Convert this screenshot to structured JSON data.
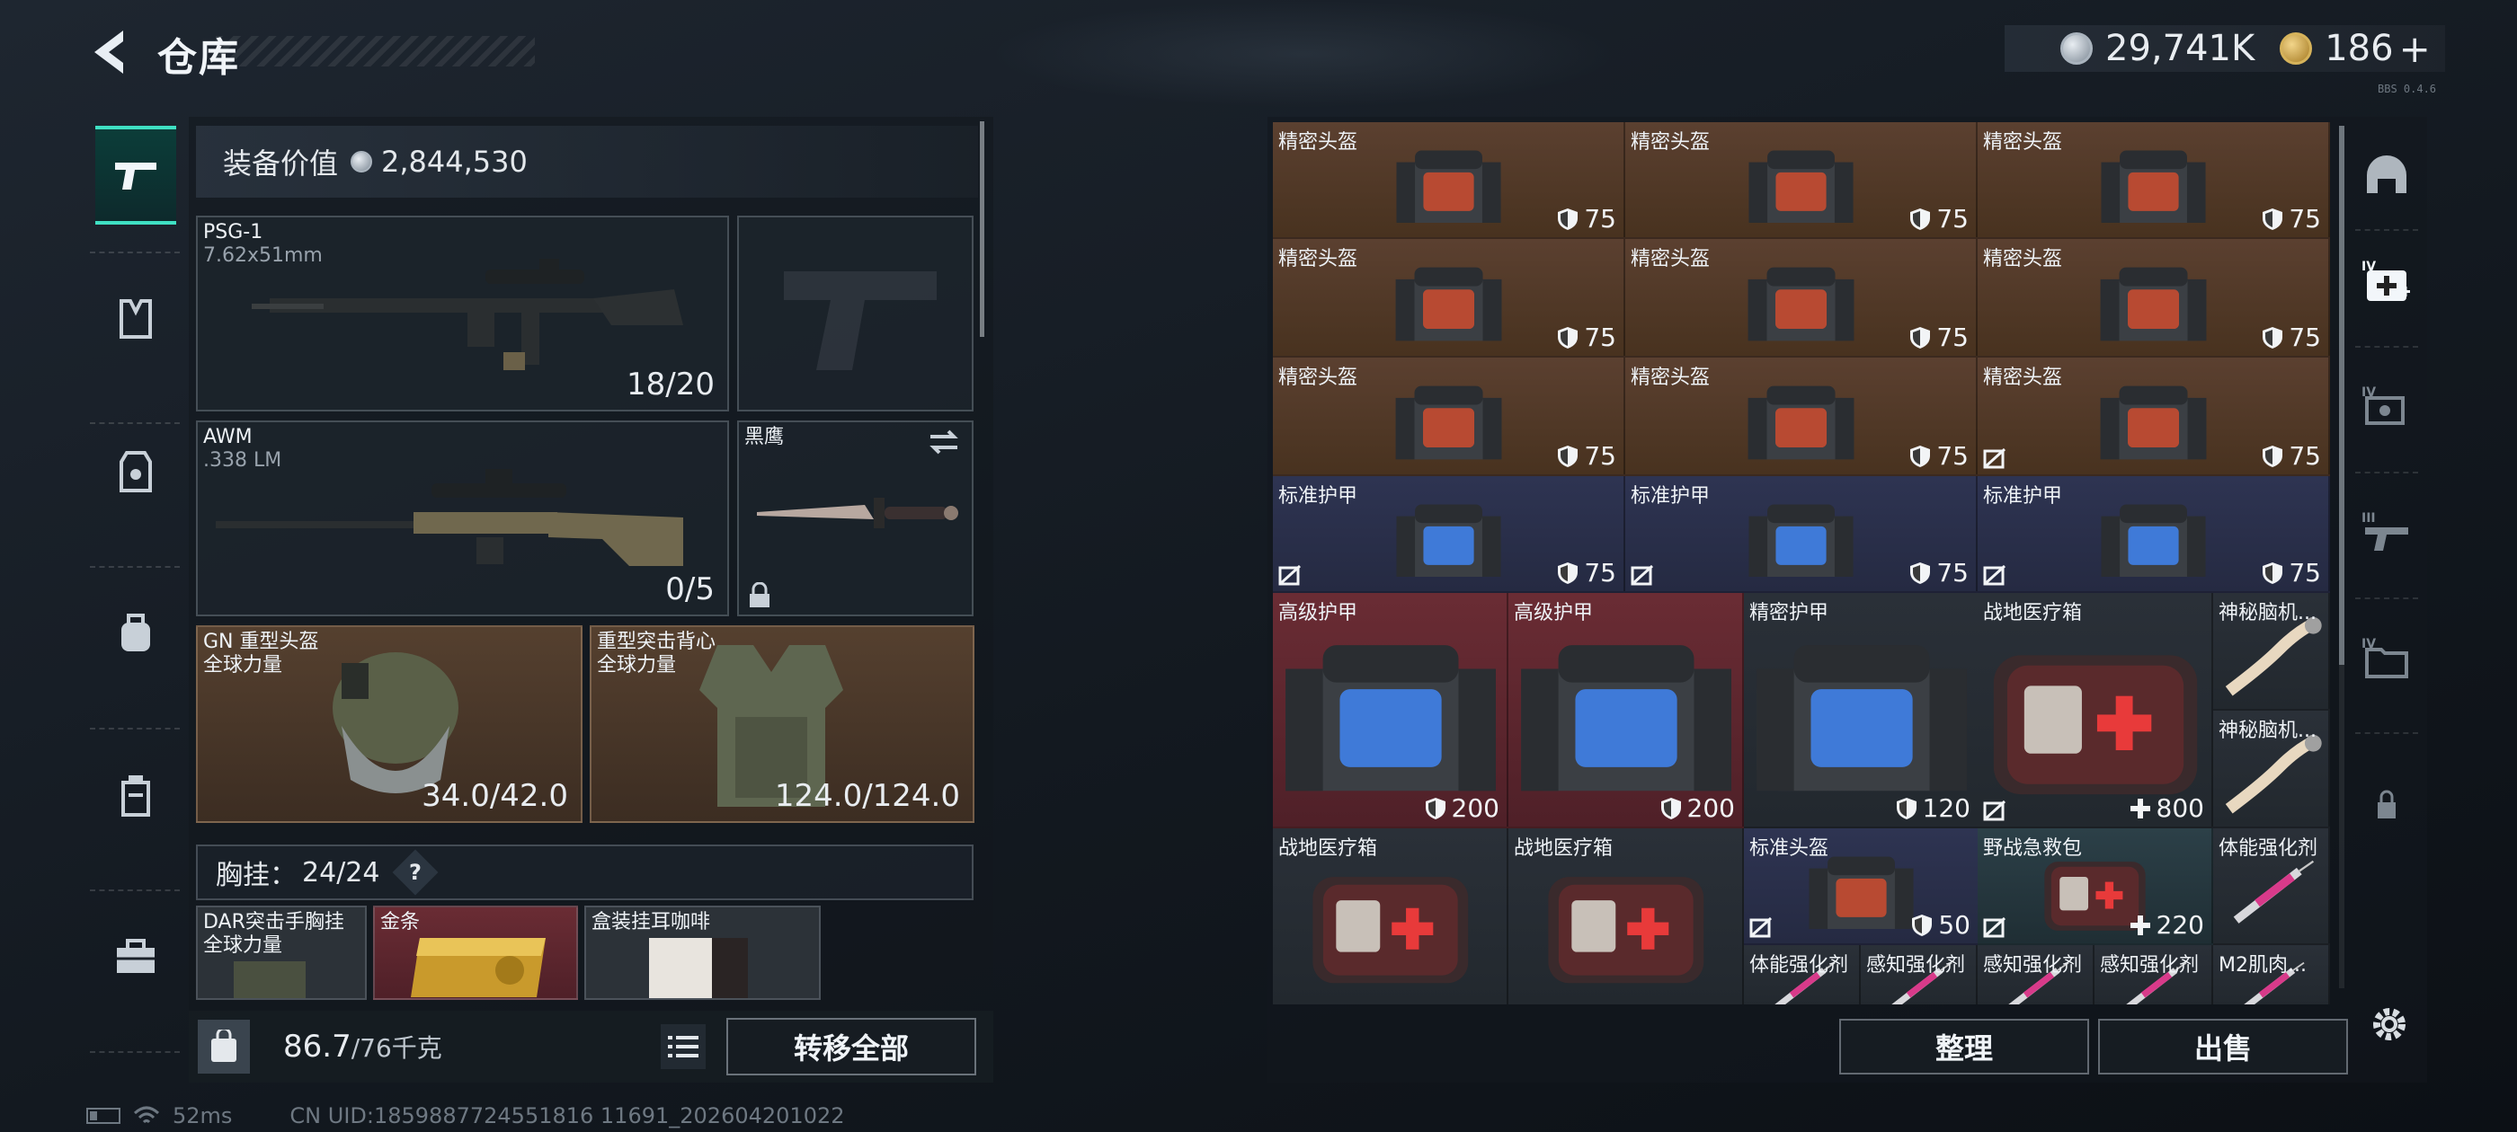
{
  "header": {
    "title": "仓库"
  },
  "currency": {
    "silver": "29,741K",
    "gold": "186",
    "plus": "+"
  },
  "version": "BBS 0.4.6",
  "equipment": {
    "value_label": "装备价值",
    "value": "2,844,530",
    "primary1": {
      "name": "PSG-1",
      "ammo": "7.62x51mm",
      "count": "18/20"
    },
    "primary2": {
      "name": "AWM",
      "ammo": ".338 LM",
      "count": "0/5"
    },
    "knife": {
      "name": "黑鹰"
    },
    "helmet": {
      "name": "GN 重型头盔",
      "origin": "全球力量",
      "durability": "34.0/42.0"
    },
    "armor": {
      "name": "重型突击背心",
      "origin": "全球力量",
      "durability": "124.0/124.0"
    },
    "vest": {
      "label": "胸挂：",
      "used": "24",
      "total": "/24",
      "help": "?"
    },
    "vest_items": [
      {
        "name": "DAR突击手胸挂",
        "sub": "全球力量"
      },
      {
        "name": "金条",
        "sub": ""
      },
      {
        "name": "盒装挂耳咖啡",
        "sub": ""
      }
    ]
  },
  "bag": {
    "weight": "86.7",
    "max": "/76千克"
  },
  "buttons": {
    "transfer_all": "转移全部",
    "sort": "整理",
    "sell": "出售"
  },
  "status": {
    "ping": "52ms",
    "uid": "CN UID:1859887724551816 11691_202604201022"
  },
  "storage": [
    {
      "name": "精密头盔",
      "value": "75",
      "kind": "helmet",
      "icon": "shield"
    },
    {
      "name": "精密头盔",
      "value": "75",
      "kind": "helmet",
      "icon": "shield"
    },
    {
      "name": "精密头盔",
      "value": "75",
      "kind": "helmet",
      "icon": "shield"
    },
    {
      "name": "精密头盔",
      "value": "75",
      "kind": "helmet",
      "icon": "shield"
    },
    {
      "name": "精密头盔",
      "value": "75",
      "kind": "helmet",
      "icon": "shield"
    },
    {
      "name": "精密头盔",
      "value": "75",
      "kind": "helmet",
      "icon": "shield"
    },
    {
      "name": "精密头盔",
      "value": "75",
      "kind": "helmet",
      "icon": "shield"
    },
    {
      "name": "精密头盔",
      "value": "75",
      "kind": "helmet",
      "icon": "shield"
    },
    {
      "name": "精密头盔",
      "value": "75",
      "kind": "helmet",
      "icon": "shield"
    },
    {
      "name": "标准护甲",
      "value": "75",
      "kind": "armor",
      "icon": "shield"
    },
    {
      "name": "标准护甲",
      "value": "75",
      "kind": "armor",
      "icon": "shield"
    },
    {
      "name": "标准护甲",
      "value": "75",
      "kind": "armor",
      "icon": "shield"
    },
    {
      "name": "高级护甲",
      "value": "200",
      "kind": "armor",
      "icon": "shield"
    },
    {
      "name": "高级护甲",
      "value": "200",
      "kind": "armor",
      "icon": "shield"
    },
    {
      "name": "精密护甲",
      "value": "120",
      "kind": "armor",
      "icon": "shield"
    },
    {
      "name": "战地医疗箱",
      "value": "800",
      "kind": "med",
      "icon": "plus"
    },
    {
      "name": "神秘脑机...",
      "value": "",
      "kind": "chip",
      "icon": ""
    },
    {
      "name": "神秘脑机...",
      "value": "",
      "kind": "chip",
      "icon": ""
    },
    {
      "name": "战地医疗箱",
      "value": "",
      "kind": "med",
      "icon": ""
    },
    {
      "name": "战地医疗箱",
      "value": "",
      "kind": "med",
      "icon": ""
    },
    {
      "name": "标准头盔",
      "value": "50",
      "kind": "helmet",
      "icon": "shield"
    },
    {
      "name": "野战急救包",
      "value": "220",
      "kind": "med",
      "icon": "plus"
    },
    {
      "name": "体能强化剂",
      "value": "",
      "kind": "syringe",
      "icon": ""
    },
    {
      "name": "体能强化剂",
      "value": "",
      "kind": "syringe",
      "icon": ""
    },
    {
      "name": "感知强化剂",
      "value": "",
      "kind": "syringe",
      "icon": ""
    },
    {
      "name": "感知强化剂",
      "value": "",
      "kind": "syringe",
      "icon": ""
    },
    {
      "name": "感知强化剂",
      "value": "",
      "kind": "syringe",
      "icon": ""
    },
    {
      "name": "M2肌肉...",
      "value": "",
      "kind": "syringe",
      "icon": ""
    }
  ],
  "right_nav": [
    {
      "icon": "helmet-icon",
      "tier": ""
    },
    {
      "icon": "medkit-icon",
      "tier": "IV"
    },
    {
      "icon": "ammo-icon",
      "tier": "IV"
    },
    {
      "icon": "gun-icon",
      "tier": "III"
    },
    {
      "icon": "folder-icon",
      "tier": "IV"
    },
    {
      "icon": "lock-icon",
      "tier": ""
    }
  ],
  "left_nav": [
    "pistol-icon",
    "vest-icon",
    "armor-icon",
    "backpack-icon",
    "bag-icon",
    "toolbox-icon"
  ]
}
